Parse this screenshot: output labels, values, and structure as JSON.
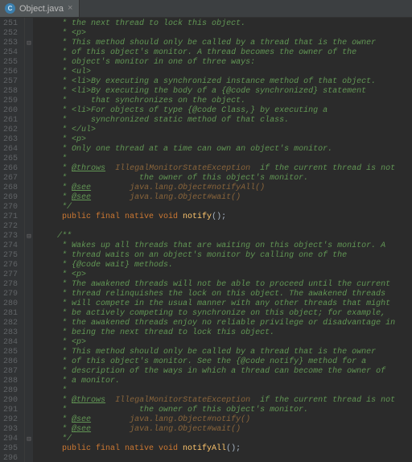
{
  "tab": {
    "filename": "Object.java",
    "icon_letter": "C",
    "close_glyph": "×"
  },
  "gutter": {
    "start": 251,
    "end": 296
  },
  "fold_markers": {
    "253": "⊟",
    "273": "⊟",
    "294": "⊟"
  },
  "lines": {
    "251": {
      "indent": "     ",
      "cls": "c",
      "text": "* the next thread to lock this object."
    },
    "252": {
      "indent": "     ",
      "cls": "c",
      "text": "* <p>"
    },
    "253": {
      "indent": "     ",
      "cls": "c",
      "text": "* This method should only be called by a thread that is the owner"
    },
    "254": {
      "indent": "     ",
      "cls": "c",
      "text": "* of this object's monitor. A thread becomes the owner of the"
    },
    "255": {
      "indent": "     ",
      "cls": "c",
      "text": "* object's monitor in one of three ways:"
    },
    "256": {
      "indent": "     ",
      "cls": "c",
      "text": "* <ul>"
    },
    "257": {
      "indent": "     ",
      "cls": "c",
      "text": "* <li>By executing a synchronized instance method of that object."
    },
    "258": {
      "indent": "     ",
      "cls": "c",
      "text": "* <li>By executing the body of a {@code synchronized} statement"
    },
    "259": {
      "indent": "     ",
      "cls": "c",
      "text": "*     that synchronizes on the object."
    },
    "260": {
      "indent": "     ",
      "cls": "c",
      "text": "* <li>For objects of type {@code Class,} by executing a"
    },
    "261": {
      "indent": "     ",
      "cls": "c",
      "text": "*     synchronized static method of that class."
    },
    "262": {
      "indent": "     ",
      "cls": "c",
      "text": "* </ul>"
    },
    "263": {
      "indent": "     ",
      "cls": "c",
      "text": "* <p>"
    },
    "264": {
      "indent": "     ",
      "cls": "c",
      "text": "* Only one thread at a time can own an object's monitor."
    },
    "265": {
      "indent": "     ",
      "cls": "c",
      "text": "*"
    },
    "266": {
      "indent": "     ",
      "segments": [
        {
          "cls": "c",
          "text": "* "
        },
        {
          "cls": "ct",
          "text": "@throws"
        },
        {
          "cls": "c",
          "text": "  "
        },
        {
          "cls": "cl",
          "text": "IllegalMonitorStateException"
        },
        {
          "cls": "c",
          "text": "  if the current thread is not"
        }
      ]
    },
    "267": {
      "indent": "     ",
      "cls": "c",
      "text": "*               the owner of this object's monitor."
    },
    "268": {
      "indent": "     ",
      "segments": [
        {
          "cls": "c",
          "text": "* "
        },
        {
          "cls": "ct",
          "text": "@see"
        },
        {
          "cls": "c",
          "text": "        "
        },
        {
          "cls": "cl",
          "text": "java.lang.Object#notifyAll()"
        }
      ]
    },
    "269": {
      "indent": "     ",
      "segments": [
        {
          "cls": "c",
          "text": "* "
        },
        {
          "cls": "ct",
          "text": "@see"
        },
        {
          "cls": "c",
          "text": "        "
        },
        {
          "cls": "cl",
          "text": "java.lang.Object#wait()"
        }
      ]
    },
    "270": {
      "indent": "     ",
      "cls": "c",
      "text": "*/"
    },
    "271": {
      "sig": {
        "mods": "public final native void ",
        "name": "notify",
        "tail": "();"
      }
    },
    "272": {
      "blank": true
    },
    "273": {
      "indent": "    ",
      "cls": "c",
      "text": "/**"
    },
    "274": {
      "indent": "     ",
      "cls": "c",
      "text": "* Wakes up all threads that are waiting on this object's monitor. A"
    },
    "275": {
      "indent": "     ",
      "cls": "c",
      "text": "* thread waits on an object's monitor by calling one of the"
    },
    "276": {
      "indent": "     ",
      "cls": "c",
      "text": "* {@code wait} methods."
    },
    "277": {
      "indent": "     ",
      "cls": "c",
      "text": "* <p>"
    },
    "278": {
      "indent": "     ",
      "cls": "c",
      "text": "* The awakened threads will not be able to proceed until the current"
    },
    "279": {
      "indent": "     ",
      "cls": "c",
      "text": "* thread relinquishes the lock on this object. The awakened threads"
    },
    "280": {
      "indent": "     ",
      "cls": "c",
      "text": "* will compete in the usual manner with any other threads that might"
    },
    "281": {
      "indent": "     ",
      "cls": "c",
      "text": "* be actively competing to synchronize on this object; for example,"
    },
    "282": {
      "indent": "     ",
      "cls": "c",
      "text": "* the awakened threads enjoy no reliable privilege or disadvantage in"
    },
    "283": {
      "indent": "     ",
      "cls": "c",
      "text": "* being the next thread to lock this object."
    },
    "284": {
      "indent": "     ",
      "cls": "c",
      "text": "* <p>"
    },
    "285": {
      "indent": "     ",
      "cls": "c",
      "text": "* This method should only be called by a thread that is the owner"
    },
    "286": {
      "indent": "     ",
      "cls": "c",
      "text": "* of this object's monitor. See the {@code notify} method for a"
    },
    "287": {
      "indent": "     ",
      "cls": "c",
      "text": "* description of the ways in which a thread can become the owner of"
    },
    "288": {
      "indent": "     ",
      "cls": "c",
      "text": "* a monitor."
    },
    "289": {
      "indent": "     ",
      "cls": "c",
      "text": "*"
    },
    "290": {
      "indent": "     ",
      "segments": [
        {
          "cls": "c",
          "text": "* "
        },
        {
          "cls": "ct",
          "text": "@throws"
        },
        {
          "cls": "c",
          "text": "  "
        },
        {
          "cls": "cl",
          "text": "IllegalMonitorStateException"
        },
        {
          "cls": "c",
          "text": "  if the current thread is not"
        }
      ]
    },
    "291": {
      "indent": "     ",
      "cls": "c",
      "text": "*               the owner of this object's monitor."
    },
    "292": {
      "indent": "     ",
      "segments": [
        {
          "cls": "c",
          "text": "* "
        },
        {
          "cls": "ct",
          "text": "@see"
        },
        {
          "cls": "c",
          "text": "        "
        },
        {
          "cls": "cl",
          "text": "java.lang.Object#notify()"
        }
      ]
    },
    "293": {
      "indent": "     ",
      "segments": [
        {
          "cls": "c",
          "text": "* "
        },
        {
          "cls": "ct",
          "text": "@see"
        },
        {
          "cls": "c",
          "text": "        "
        },
        {
          "cls": "cl",
          "text": "java.lang.Object#wait()"
        }
      ]
    },
    "294": {
      "indent": "     ",
      "cls": "c",
      "text": "*/"
    },
    "295": {
      "sig": {
        "mods": "public final native void ",
        "name": "notifyAll",
        "tail": "();"
      }
    },
    "296": {
      "blank": true
    }
  }
}
